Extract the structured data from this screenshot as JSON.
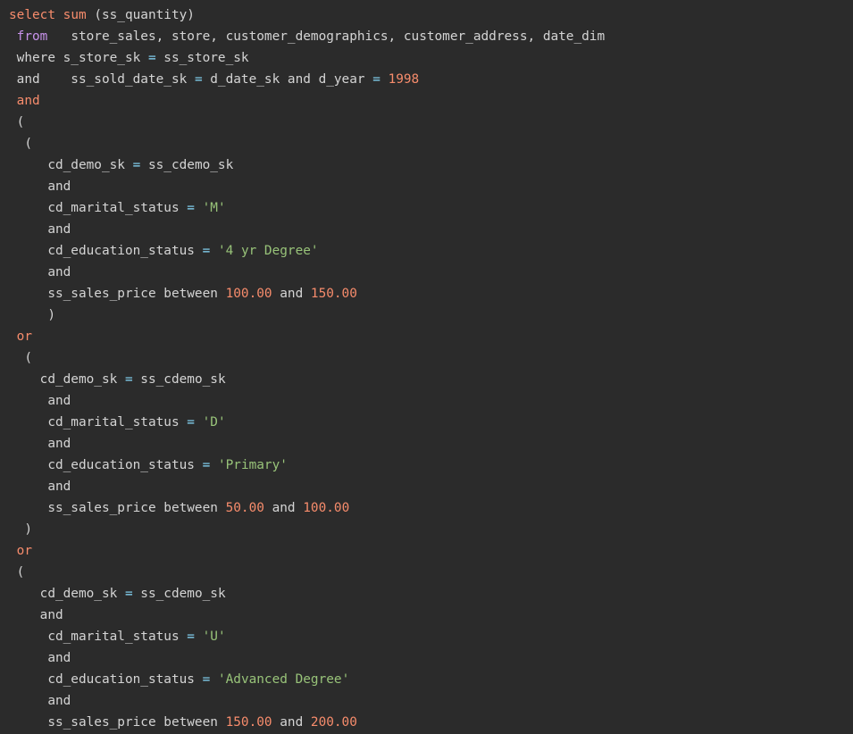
{
  "colors": {
    "background": "#2b2b2b",
    "text": "#d4d4d4",
    "keyword_pink": "#c792ea",
    "keyword_orange": "#f78c6c",
    "operator": "#89ddff",
    "number": "#f78c6c",
    "string": "#98c379"
  },
  "code": {
    "lines": [
      [
        {
          "t": "select",
          "c": "kw-orange"
        },
        {
          "t": " "
        },
        {
          "t": "sum",
          "c": "kw-orange"
        },
        {
          "t": " (ss_quantity)"
        }
      ],
      [
        {
          "t": " "
        },
        {
          "t": "from",
          "c": "kw-pink"
        },
        {
          "t": "   store_sales, store, customer_demographics, customer_address, date_dim"
        }
      ],
      [
        {
          "t": " where s_store_sk "
        },
        {
          "t": "=",
          "c": "op"
        },
        {
          "t": " ss_store_sk"
        }
      ],
      [
        {
          "t": " and    ss_sold_date_sk "
        },
        {
          "t": "=",
          "c": "op"
        },
        {
          "t": " d_date_sk and d_year "
        },
        {
          "t": "=",
          "c": "op"
        },
        {
          "t": " "
        },
        {
          "t": "1998",
          "c": "num"
        }
      ],
      [
        {
          "t": " "
        },
        {
          "t": "and",
          "c": "kw-orange"
        }
      ],
      [
        {
          "t": " ("
        }
      ],
      [
        {
          "t": "  ("
        }
      ],
      [
        {
          "t": "     cd_demo_sk "
        },
        {
          "t": "=",
          "c": "op"
        },
        {
          "t": " ss_cdemo_sk"
        }
      ],
      [
        {
          "t": "     and"
        }
      ],
      [
        {
          "t": "     cd_marital_status "
        },
        {
          "t": "=",
          "c": "op"
        },
        {
          "t": " "
        },
        {
          "t": "'M'",
          "c": "str"
        }
      ],
      [
        {
          "t": "     and"
        }
      ],
      [
        {
          "t": "     cd_education_status "
        },
        {
          "t": "=",
          "c": "op"
        },
        {
          "t": " "
        },
        {
          "t": "'4 yr Degree'",
          "c": "str"
        }
      ],
      [
        {
          "t": "     and"
        }
      ],
      [
        {
          "t": "     ss_sales_price between "
        },
        {
          "t": "100.00",
          "c": "num"
        },
        {
          "t": " and "
        },
        {
          "t": "150.00",
          "c": "num"
        }
      ],
      [
        {
          "t": "     )"
        }
      ],
      [
        {
          "t": " "
        },
        {
          "t": "or",
          "c": "kw-orange"
        }
      ],
      [
        {
          "t": "  ("
        }
      ],
      [
        {
          "t": "    cd_demo_sk "
        },
        {
          "t": "=",
          "c": "op"
        },
        {
          "t": " ss_cdemo_sk"
        }
      ],
      [
        {
          "t": "     and"
        }
      ],
      [
        {
          "t": "     cd_marital_status "
        },
        {
          "t": "=",
          "c": "op"
        },
        {
          "t": " "
        },
        {
          "t": "'D'",
          "c": "str"
        }
      ],
      [
        {
          "t": "     and"
        }
      ],
      [
        {
          "t": "     cd_education_status "
        },
        {
          "t": "=",
          "c": "op"
        },
        {
          "t": " "
        },
        {
          "t": "'Primary'",
          "c": "str"
        }
      ],
      [
        {
          "t": "     and"
        }
      ],
      [
        {
          "t": "     ss_sales_price between "
        },
        {
          "t": "50.00",
          "c": "num"
        },
        {
          "t": " and "
        },
        {
          "t": "100.00",
          "c": "num"
        }
      ],
      [
        {
          "t": "  )"
        }
      ],
      [
        {
          "t": " "
        },
        {
          "t": "or",
          "c": "kw-orange"
        }
      ],
      [
        {
          "t": " ("
        }
      ],
      [
        {
          "t": "    cd_demo_sk "
        },
        {
          "t": "=",
          "c": "op"
        },
        {
          "t": " ss_cdemo_sk"
        }
      ],
      [
        {
          "t": "    and"
        }
      ],
      [
        {
          "t": "     cd_marital_status "
        },
        {
          "t": "=",
          "c": "op"
        },
        {
          "t": " "
        },
        {
          "t": "'U'",
          "c": "str"
        }
      ],
      [
        {
          "t": "     and"
        }
      ],
      [
        {
          "t": "     cd_education_status "
        },
        {
          "t": "=",
          "c": "op"
        },
        {
          "t": " "
        },
        {
          "t": "'Advanced Degree'",
          "c": "str"
        }
      ],
      [
        {
          "t": "     and"
        }
      ],
      [
        {
          "t": "     ss_sales_price between "
        },
        {
          "t": "150.00",
          "c": "num"
        },
        {
          "t": " and "
        },
        {
          "t": "200.00",
          "c": "num"
        }
      ]
    ]
  }
}
